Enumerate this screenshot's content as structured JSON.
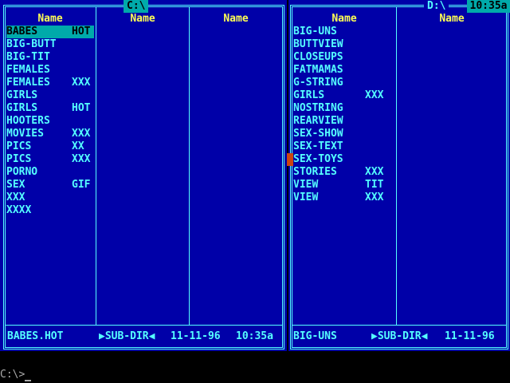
{
  "left_panel": {
    "drive_title": "C:\\",
    "col_headers": [
      "Name",
      "Name",
      "Name"
    ],
    "files": [
      {
        "name": "BABES",
        "ext": "HOT",
        "selected": true
      },
      {
        "name": "BIG-BUTT",
        "ext": ""
      },
      {
        "name": "BIG-TIT",
        "ext": ""
      },
      {
        "name": "FEMALES",
        "ext": ""
      },
      {
        "name": "FEMALES",
        "ext": "XXX"
      },
      {
        "name": "GIRLS",
        "ext": ""
      },
      {
        "name": "GIRLS",
        "ext": "HOT"
      },
      {
        "name": "HOOTERS",
        "ext": ""
      },
      {
        "name": "MOVIES",
        "ext": "XXX"
      },
      {
        "name": "PICS",
        "ext": "XX"
      },
      {
        "name": "PICS",
        "ext": "XXX"
      },
      {
        "name": "PORNO",
        "ext": ""
      },
      {
        "name": "SEX",
        "ext": "GIF"
      },
      {
        "name": "XXX",
        "ext": ""
      },
      {
        "name": "XXXX",
        "ext": ""
      }
    ],
    "status": {
      "name": "BABES.HOT",
      "type": "▶SUB-DIR◀",
      "date": "11-11-96",
      "time": "10:35a"
    }
  },
  "right_panel": {
    "drive_title": "D:\\",
    "col_headers": [
      "Name",
      "Name"
    ],
    "files": [
      {
        "name": "BIG-UNS",
        "ext": ""
      },
      {
        "name": "BUTTVIEW",
        "ext": ""
      },
      {
        "name": "CLOSEUPS",
        "ext": ""
      },
      {
        "name": "FATMAMAS",
        "ext": ""
      },
      {
        "name": "G-STRING",
        "ext": ""
      },
      {
        "name": "GIRLS",
        "ext": "XXX"
      },
      {
        "name": "NOSTRING",
        "ext": ""
      },
      {
        "name": "REARVIEW",
        "ext": ""
      },
      {
        "name": "SEX-SHOW",
        "ext": ""
      },
      {
        "name": "SEX-TEXT",
        "ext": ""
      },
      {
        "name": "SEX-TOYS",
        "ext": ""
      },
      {
        "name": "STORIES",
        "ext": "XXX"
      },
      {
        "name": "VIEW",
        "ext": "TIT"
      },
      {
        "name": "VIEW",
        "ext": "XXX"
      }
    ],
    "status": {
      "name": "BIG-UNS",
      "type": "▶SUB-DIR◀",
      "date": "11-11-96"
    }
  },
  "clock": "10:35a",
  "command_line": {
    "prompt": "C:\\>"
  },
  "colors": {
    "panel_bg": "#0000A8",
    "frame": "#55FFFF",
    "header_text": "#FFFF55",
    "highlight": "#00AAAA"
  }
}
